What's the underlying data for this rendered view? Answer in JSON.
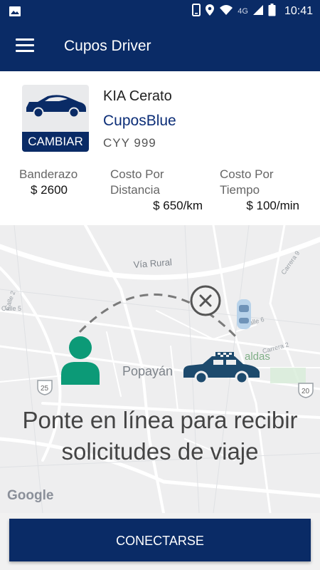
{
  "status_bar": {
    "network": "4G",
    "time": "10:41"
  },
  "app_bar": {
    "title": "Cupos Driver"
  },
  "vehicle": {
    "change_label": "CAMBIAR",
    "model": "KIA Cerato",
    "company": "CuposBlue",
    "plate": "CYY 999"
  },
  "fares": {
    "flag_label": "Banderazo",
    "flag_value": "$ 2600",
    "distance_label": "Costo Por Distancia",
    "distance_value": "$ 650/km",
    "time_label": "Costo Por Tiempo",
    "time_value": "$ 100/min"
  },
  "map": {
    "labels": {
      "via_rural": "Vía Rural",
      "carrera9": "Carrera 9",
      "calle2_a": "Calle 2",
      "calle5": "Calle 5",
      "calle6": "Calle 6",
      "carrera2": "Carrera 2",
      "city": "Popayán",
      "ldas": "aldas",
      "route25": "25",
      "route20": "20"
    },
    "attribution": "Google"
  },
  "message_line1": "Ponte en línea para recibir",
  "message_line2": "solicitudes de viaje",
  "connect_label": "CONECTARSE",
  "colors": {
    "primary": "#0a2b66",
    "person": "#0c9a77",
    "taxi": "#1d4a6d"
  }
}
